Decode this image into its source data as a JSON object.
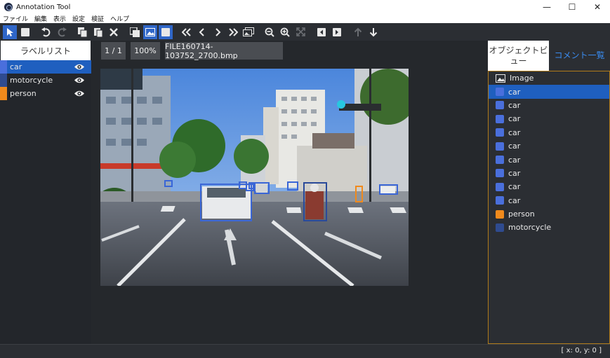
{
  "window": {
    "title": "Annotation Tool",
    "minimize": "—",
    "maximize": "☐",
    "close": "✕"
  },
  "menu": [
    "ファイル",
    "編集",
    "表示",
    "設定",
    "検証",
    "ヘルプ"
  ],
  "left_panel": {
    "header": "ラベルリスト",
    "labels": [
      {
        "name": "car",
        "color": "#4a6fdc",
        "selected": true
      },
      {
        "name": "motorcycle",
        "color": "#2f4b8f",
        "selected": false
      },
      {
        "name": "person",
        "color": "#f08a1c",
        "selected": false
      }
    ]
  },
  "center": {
    "page": "1 / 1",
    "zoom": "100%",
    "filename": "FILE160714-103752_2700.bmp"
  },
  "right_panel": {
    "tab_objects": "オブジェクトビュー",
    "tab_comments": "コメント一覧",
    "image_label": "Image",
    "objects": [
      {
        "label": "car",
        "color": "#4a6fdc",
        "selected": true
      },
      {
        "label": "car",
        "color": "#4a6fdc"
      },
      {
        "label": "car",
        "color": "#4a6fdc"
      },
      {
        "label": "car",
        "color": "#4a6fdc"
      },
      {
        "label": "car",
        "color": "#4a6fdc"
      },
      {
        "label": "car",
        "color": "#4a6fdc"
      },
      {
        "label": "car",
        "color": "#4a6fdc"
      },
      {
        "label": "car",
        "color": "#4a6fdc"
      },
      {
        "label": "car",
        "color": "#4a6fdc"
      },
      {
        "label": "person",
        "color": "#f08a1c"
      },
      {
        "label": "motorcycle",
        "color": "#2f4b8f"
      }
    ]
  },
  "status": {
    "coords": "[ x: 0, y: 0 ]"
  }
}
